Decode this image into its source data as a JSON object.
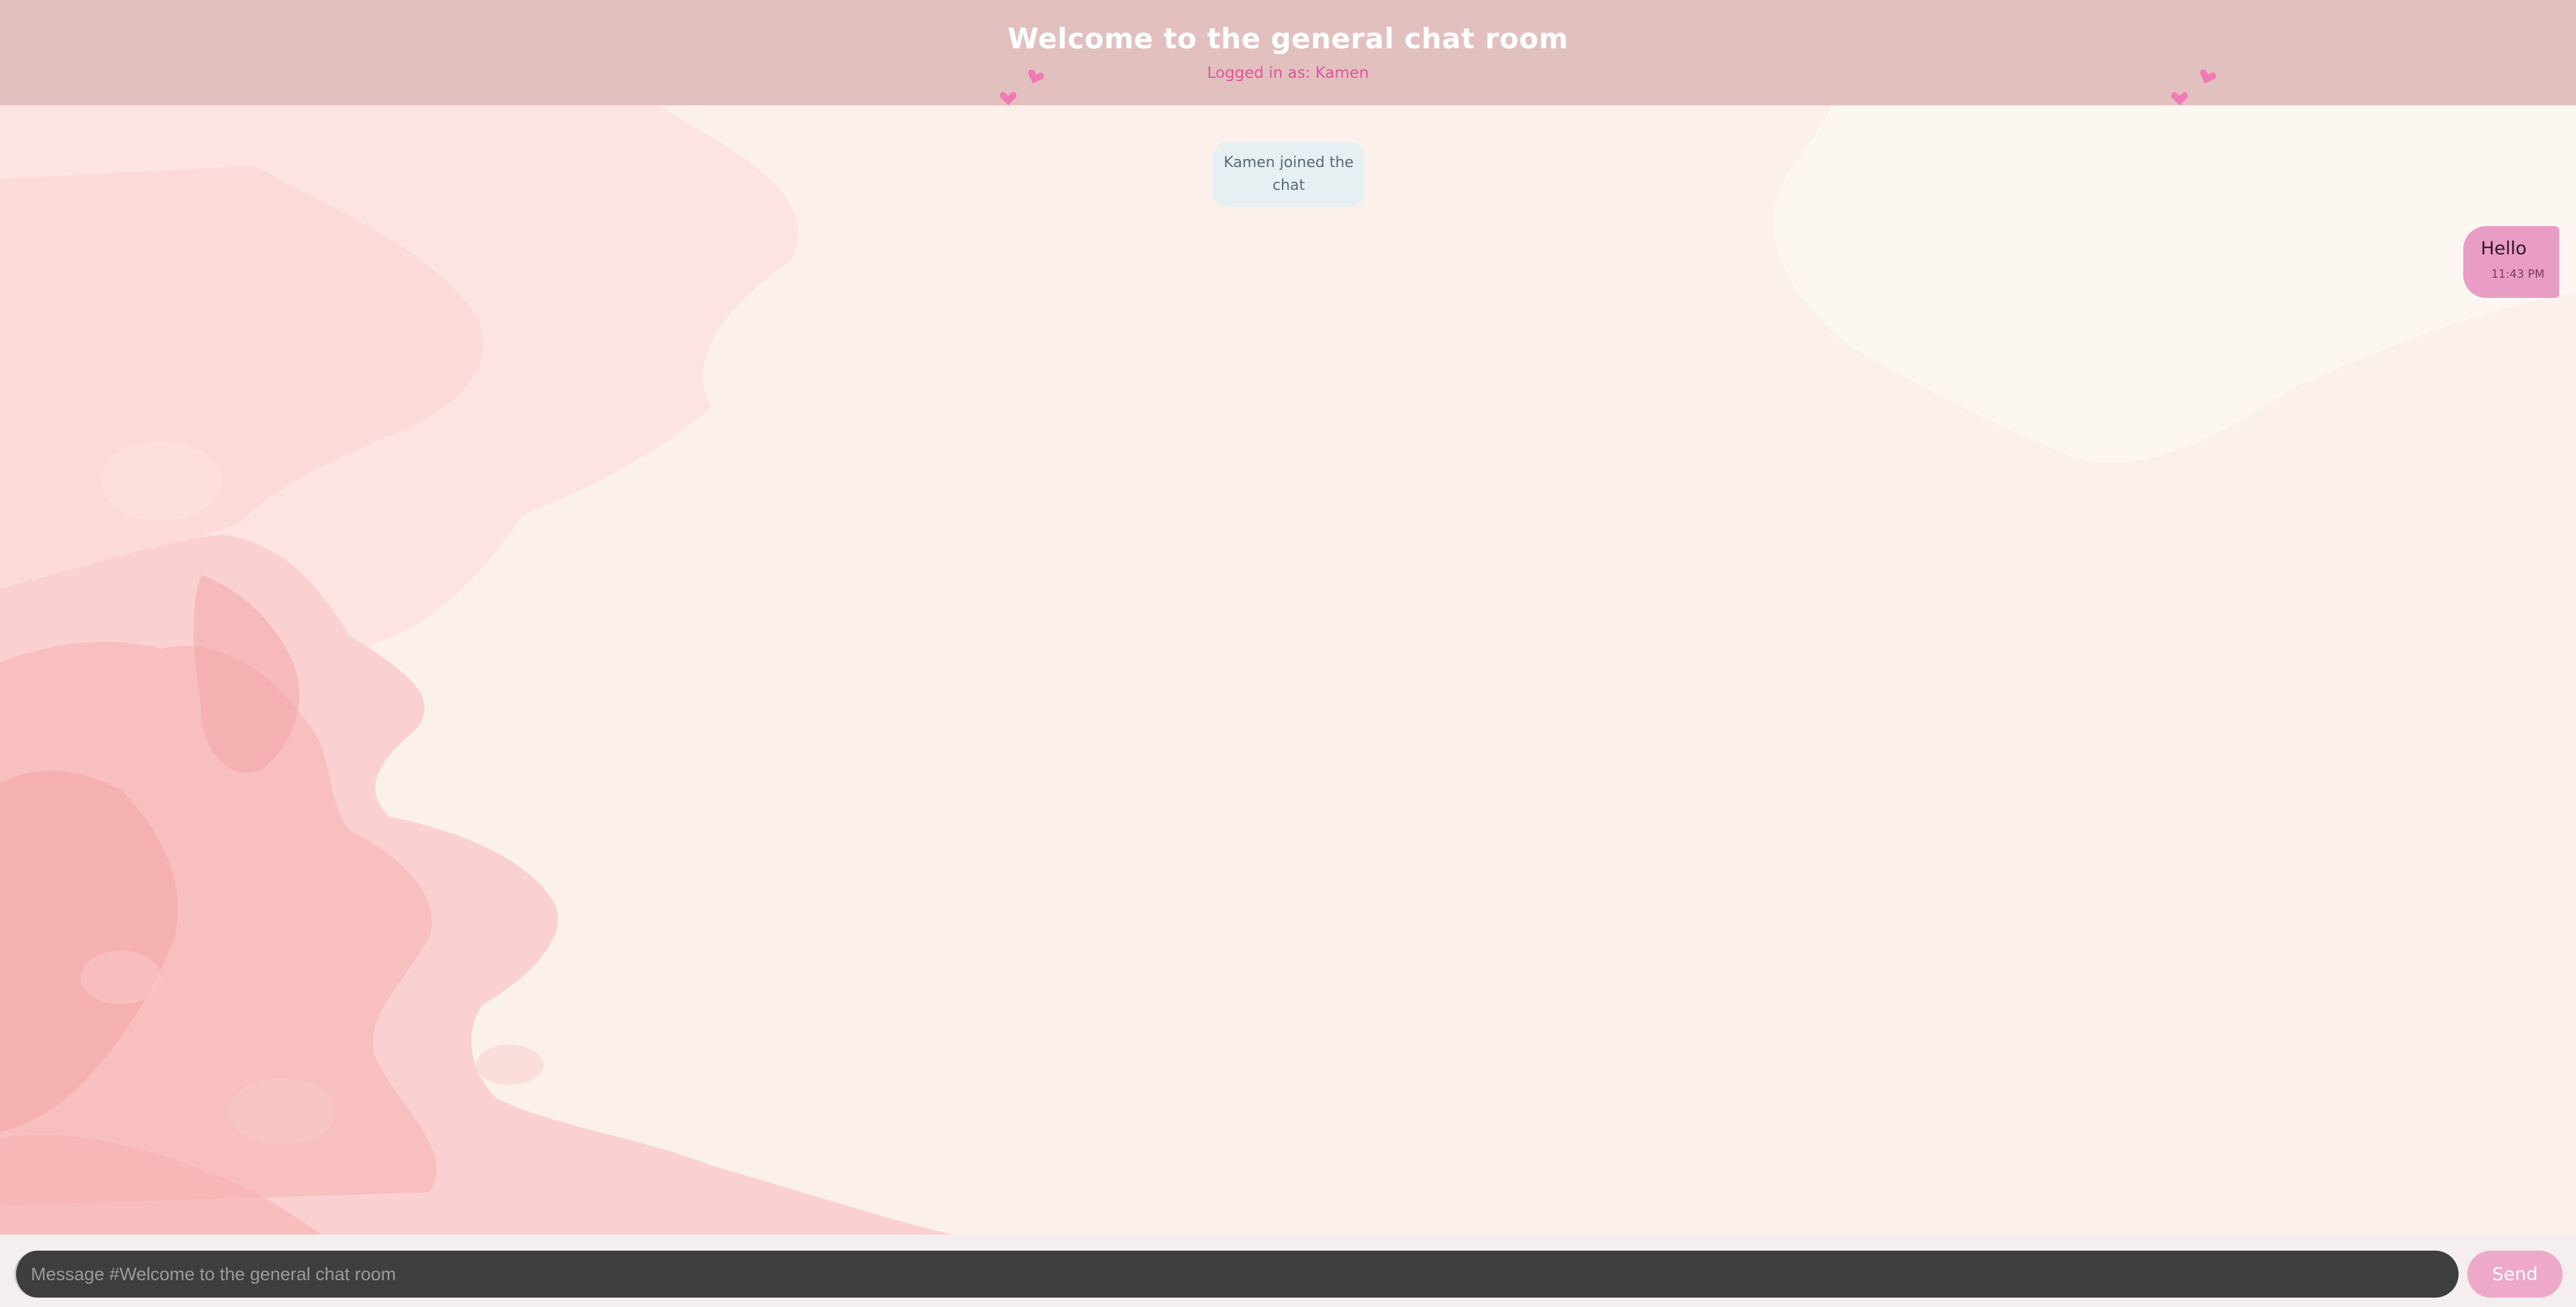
{
  "header": {
    "title": "Welcome to the general chat room",
    "logged_in": "Logged in as: Kamen"
  },
  "messages": {
    "system": "Kamen joined the chat",
    "own": {
      "text": "Hello",
      "time": "11:43 PM"
    }
  },
  "composer": {
    "placeholder": "Message #Welcome to the general chat room",
    "send_label": "Send"
  },
  "colors": {
    "header_bg": "#e3c0c0",
    "accent_pink": "#e0559a",
    "bubble_bg": "#e89cc6",
    "send_bg": "#eea8c8",
    "input_bg": "#3e3e3e",
    "page_bg": "#fbf1ea"
  },
  "icons": [
    "heart-icon"
  ]
}
